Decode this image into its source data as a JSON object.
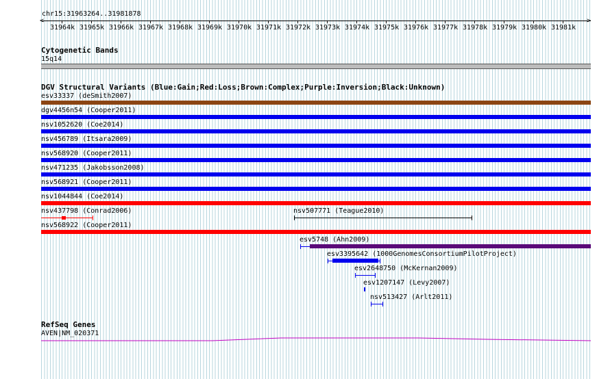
{
  "ruler": {
    "title": "chr15:31963264..31981878",
    "ticks": [
      "31964k",
      "31965k",
      "31966k",
      "31967k",
      "31968k",
      "31969k",
      "31970k",
      "31971k",
      "31972k",
      "31973k",
      "31974k",
      "31975k",
      "31976k",
      "31977k",
      "31978k",
      "31979k",
      "31980k",
      "31981k"
    ]
  },
  "cytoband": {
    "title": "Cytogenetic Bands",
    "label": "15q14"
  },
  "dgv": {
    "title": "DGV Structural Variants (Blue:Gain;Red:Loss;Brown:Complex;Purple:Inversion;Black:Unknown)",
    "colors": {
      "gain": "#0000ee",
      "loss": "#ff0000",
      "complex": "#8b4513",
      "inversion": "#5a0a78",
      "unknown": "#000000"
    },
    "full": [
      {
        "label": "esv33337 (deSmith2007)",
        "type": "complex"
      },
      {
        "label": "dgv4456n54 (Cooper2011)",
        "type": "gain"
      },
      {
        "label": "nsv1052620 (Coe2014)",
        "type": "gain"
      },
      {
        "label": "nsv456789 (Itsara2009)",
        "type": "gain"
      },
      {
        "label": "nsv568920 (Cooper2011)",
        "type": "gain"
      },
      {
        "label": "nsv471235 (Jakobsson2008)",
        "type": "gain"
      },
      {
        "label": "nsv568921 (Cooper2011)",
        "type": "gain"
      },
      {
        "label": "nsv1044844 (Coe2014)",
        "type": "loss"
      }
    ],
    "row_small": {
      "left_label": "nsv437798 (Conrad2006)",
      "right_label": "nsv507771 (Teague2010)"
    },
    "nsv568922": "nsv568922 (Cooper2011)",
    "esv5748": "esv5748 (Ahn2009)",
    "esv3395642": "esv3395642 (1000GenomesConsortiumPilotProject)",
    "esv2648750": "esv2648750 (McKernan2009)",
    "esv1207147": "esv1207147 (Levy2007)",
    "nsv513427": "nsv513427 (Arlt2011)"
  },
  "refseq": {
    "title": "RefSeq Genes",
    "gene": "AVEN|NM_020371",
    "color": "#c000c0"
  }
}
